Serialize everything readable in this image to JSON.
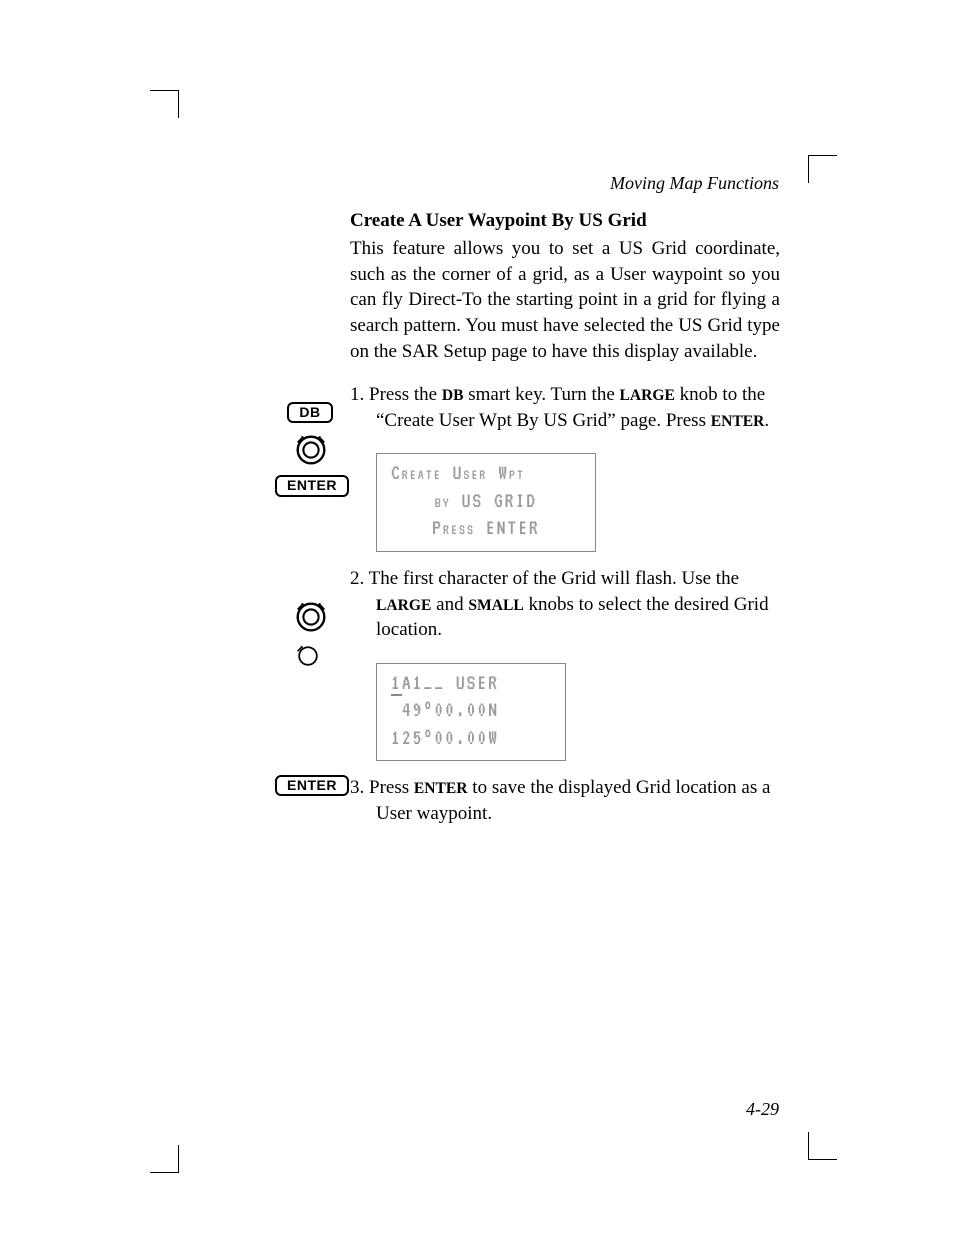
{
  "running_head": "Moving Map Functions",
  "page_number": "4-29",
  "section_title": "Create A User Waypoint By US Grid",
  "intro": "This feature allows you to set a US Grid coordinate, such as the corner of a grid, as a User waypoint so you can fly Direct-To the starting point in a grid for flying a search pattern. You must have selected the US Grid type on the SAR Setup page to have this display available.",
  "steps": {
    "s1_pre": "1. Press the ",
    "s1_db": "DB",
    "s1_mid": " smart key. Turn the ",
    "s1_large": "LARGE",
    "s1_post": " knob to the “Create User Wpt By US Grid” page. Press ",
    "s1_enter": "ENTER",
    "s1_period": ".",
    "s2_pre": "2. The first character of the Grid will flash. Use the ",
    "s2_large": "LARGE",
    "s2_and": " and ",
    "s2_small": "SMALL",
    "s2_post": " knobs to select the desired Grid location.",
    "s3_pre": "3. Press ",
    "s3_enter": "ENTER",
    "s3_post": " to save the displayed Grid location as a User waypoint."
  },
  "keys": {
    "db": "DB",
    "enter": "ENTER"
  },
  "lcd1": {
    "l1": "Create User Wpt",
    "l2": "by US GRID",
    "l3": "Press ENTER"
  },
  "lcd2": {
    "l1a": "1",
    "l1b": "A1__ USER",
    "l2": " 49°00.00N",
    "l3": "125°00.00W"
  }
}
